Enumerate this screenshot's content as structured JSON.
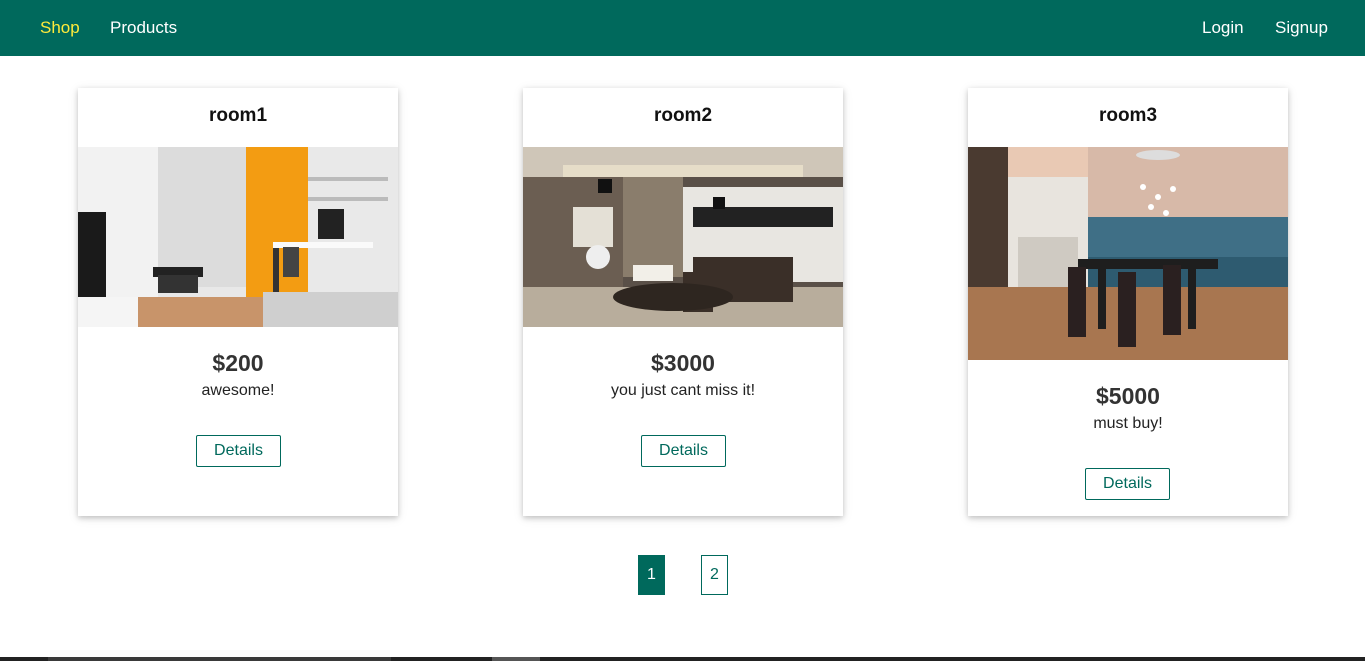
{
  "nav": {
    "left": [
      {
        "label": "Shop",
        "active": true
      },
      {
        "label": "Products",
        "active": false
      }
    ],
    "right": [
      {
        "label": "Login"
      },
      {
        "label": "Signup"
      }
    ]
  },
  "cards": [
    {
      "title": "room1",
      "price": "$200",
      "description": "awesome!",
      "button": "Details",
      "image": "room1-photo"
    },
    {
      "title": "room2",
      "price": "$3000",
      "description": "you just cant miss it!",
      "button": "Details",
      "image": "room2-photo"
    },
    {
      "title": "room3",
      "price": "$5000",
      "description": "must buy!",
      "button": "Details",
      "image": "room3-photo"
    }
  ],
  "pagination": [
    {
      "label": "1",
      "active": true
    },
    {
      "label": "2",
      "active": false
    }
  ],
  "colors": {
    "primary": "#00695c",
    "nav_active": "#ffeb3b",
    "white": "#ffffff"
  }
}
